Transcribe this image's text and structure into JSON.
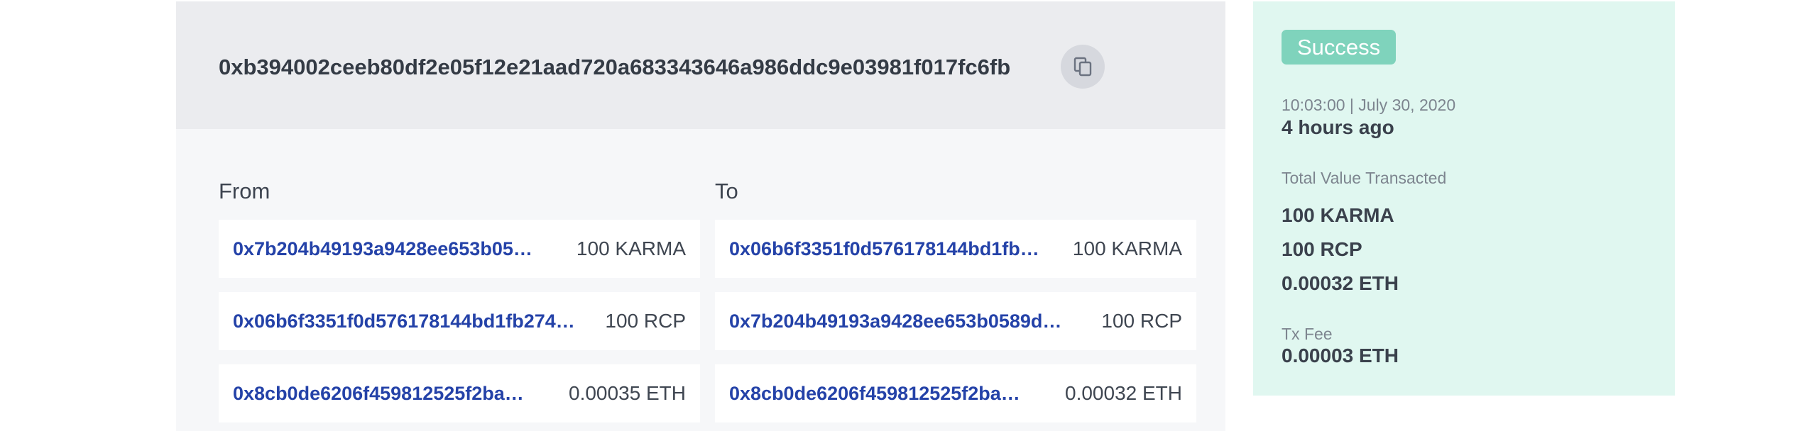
{
  "transaction": {
    "hash": "0xb394002ceeb80df2e05f12e21aad720a683343646a986ddc9e03981f017fc6fb",
    "copy_icon": "copy-icon"
  },
  "from": {
    "title": "From",
    "rows": [
      {
        "address": "0x7b204b49193a9428ee653b05…",
        "amount": "100 KARMA"
      },
      {
        "address": "0x06b6f3351f0d576178144bd1fb274…",
        "amount": "100 RCP"
      },
      {
        "address": "0x8cb0de6206f459812525f2ba…",
        "amount": "0.00035 ETH"
      }
    ]
  },
  "to": {
    "title": "To",
    "rows": [
      {
        "address": "0x06b6f3351f0d576178144bd1fb…",
        "amount": "100 KARMA"
      },
      {
        "address": "0x7b204b49193a9428ee653b0589d…",
        "amount": "100 RCP"
      },
      {
        "address": "0x8cb0de6206f459812525f2ba…",
        "amount": "0.00032 ETH"
      }
    ]
  },
  "summary": {
    "status": "Success",
    "timestamp": "10:03:00 | July 30, 2020",
    "relative_time": "4 hours ago",
    "total_label": "Total Value Transacted",
    "totals": [
      "100 KARMA",
      "100 RCP",
      "0.00032 ETH"
    ],
    "fee_label": "Tx Fee",
    "fee_value": "0.00003 ETH"
  },
  "colors": {
    "link": "#2442a8",
    "success_badge": "#7fd3bc",
    "summary_bg": "#e0f7f0"
  }
}
